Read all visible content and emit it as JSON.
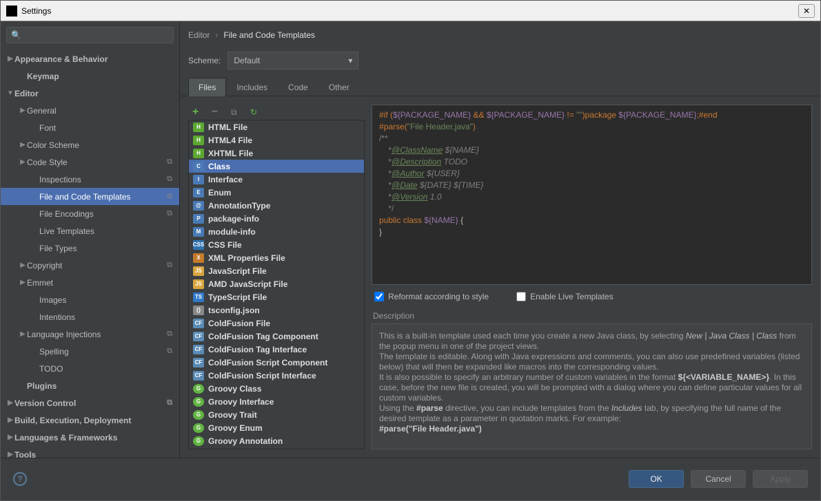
{
  "window": {
    "title": "Settings"
  },
  "search": {
    "placeholder": "Q"
  },
  "sidebar": [
    {
      "label": "Appearance & Behavior",
      "arrow": "closed",
      "bold": true,
      "ind": 0
    },
    {
      "label": "Keymap",
      "bold": true,
      "ind": 1
    },
    {
      "label": "Editor",
      "arrow": "open",
      "bold": true,
      "ind": 0
    },
    {
      "label": "General",
      "arrow": "closed",
      "ind": 1
    },
    {
      "label": "Font",
      "ind": 2
    },
    {
      "label": "Color Scheme",
      "arrow": "closed",
      "ind": 1
    },
    {
      "label": "Code Style",
      "arrow": "closed",
      "ind": 1,
      "copy": true
    },
    {
      "label": "Inspections",
      "ind": 2,
      "copy": true
    },
    {
      "label": "File and Code Templates",
      "ind": 2,
      "copy": true,
      "selected": true
    },
    {
      "label": "File Encodings",
      "ind": 2,
      "copy": true
    },
    {
      "label": "Live Templates",
      "ind": 2
    },
    {
      "label": "File Types",
      "ind": 2
    },
    {
      "label": "Copyright",
      "arrow": "closed",
      "ind": 1,
      "copy": true
    },
    {
      "label": "Emmet",
      "arrow": "closed",
      "ind": 1
    },
    {
      "label": "Images",
      "ind": 2
    },
    {
      "label": "Intentions",
      "ind": 2
    },
    {
      "label": "Language Injections",
      "arrow": "closed",
      "ind": 1,
      "copy": true
    },
    {
      "label": "Spelling",
      "ind": 2,
      "copy": true
    },
    {
      "label": "TODO",
      "ind": 2
    },
    {
      "label": "Plugins",
      "bold": true,
      "ind": 1
    },
    {
      "label": "Version Control",
      "arrow": "closed",
      "bold": true,
      "ind": 0,
      "copy": true
    },
    {
      "label": "Build, Execution, Deployment",
      "arrow": "closed",
      "bold": true,
      "ind": 0
    },
    {
      "label": "Languages & Frameworks",
      "arrow": "closed",
      "bold": true,
      "ind": 0
    },
    {
      "label": "Tools",
      "arrow": "closed",
      "bold": true,
      "ind": 0
    }
  ],
  "breadcrumb": {
    "root": "Editor",
    "current": "File and Code Templates"
  },
  "scheme": {
    "label": "Scheme:",
    "value": "Default"
  },
  "tabs": [
    "Files",
    "Includes",
    "Code",
    "Other"
  ],
  "activeTab": 0,
  "templates": [
    {
      "name": "HTML File",
      "icon": "html",
      "t": "H"
    },
    {
      "name": "HTML4 File",
      "icon": "html",
      "t": "H"
    },
    {
      "name": "XHTML File",
      "icon": "html",
      "t": "H"
    },
    {
      "name": "Class",
      "icon": "cls",
      "t": "C",
      "selected": true
    },
    {
      "name": "Interface",
      "icon": "cls",
      "t": "I"
    },
    {
      "name": "Enum",
      "icon": "cls",
      "t": "E"
    },
    {
      "name": "AnnotationType",
      "icon": "cls",
      "t": "@"
    },
    {
      "name": "package-info",
      "icon": "cls",
      "t": "P"
    },
    {
      "name": "module-info",
      "icon": "cls",
      "t": "M"
    },
    {
      "name": "CSS File",
      "icon": "css",
      "t": "CSS"
    },
    {
      "name": "XML Properties File",
      "icon": "xml",
      "t": "X"
    },
    {
      "name": "JavaScript File",
      "icon": "js",
      "t": "JS"
    },
    {
      "name": "AMD JavaScript File",
      "icon": "js",
      "t": "JS"
    },
    {
      "name": "TypeScript File",
      "icon": "ts",
      "t": "TS"
    },
    {
      "name": "tsconfig.json",
      "icon": "json",
      "t": "{}"
    },
    {
      "name": "ColdFusion File",
      "icon": "cf",
      "t": "CF"
    },
    {
      "name": "ColdFusion Tag Component",
      "icon": "cf",
      "t": "CF"
    },
    {
      "name": "ColdFusion Tag Interface",
      "icon": "cf",
      "t": "CF"
    },
    {
      "name": "ColdFusion Script Component",
      "icon": "cf",
      "t": "CF"
    },
    {
      "name": "ColdFusion Script Interface",
      "icon": "cf",
      "t": "CF"
    },
    {
      "name": "Groovy Class",
      "icon": "groovy",
      "t": "G"
    },
    {
      "name": "Groovy Interface",
      "icon": "groovy",
      "t": "G"
    },
    {
      "name": "Groovy Trait",
      "icon": "groovy",
      "t": "G"
    },
    {
      "name": "Groovy Enum",
      "icon": "groovy",
      "t": "G"
    },
    {
      "name": "Groovy Annotation",
      "icon": "groovy",
      "t": "G"
    }
  ],
  "code": {
    "l1a": "#if (",
    "l1b": "${PACKAGE_NAME}",
    "l1c": " && ",
    "l1d": "${PACKAGE_NAME}",
    "l1e": " != ",
    "l1f": "\"\"",
    "l1g": ")",
    "l1h": "package ",
    "l1i": "${PACKAGE_NAME}",
    "l1j": ";#end",
    "l2a": "#parse(",
    "l2b": "\"File Header.java\"",
    "l2c": ")",
    "l3": "/**",
    "l4a": "    *",
    "l4b": "@ClassName",
    "l4c": " ${NAME}",
    "l5a": "    *",
    "l5b": "@Description",
    "l5c": " TODO",
    "l6a": "    *",
    "l6b": "@Author",
    "l6c": " ${USER}",
    "l7a": "    *",
    "l7b": "@Date",
    "l7c": " ${DATE} ${TIME}",
    "l8a": "    *",
    "l8b": "@Version",
    "l8c": " 1.0",
    "l9": "    */",
    "l10a": "public class ",
    "l10b": "${NAME}",
    "l10c": " {",
    "l11": "}"
  },
  "checkboxes": {
    "reformat": "Reformat according to style",
    "liveTemplates": "Enable Live Templates"
  },
  "descLabel": "Description",
  "description": {
    "t1": "This is a built-in template used each time you create a new Java class, by selecting ",
    "i1": "New | Java Class | Class",
    "t2": " from the popup menu in one of the project views.",
    "t3": "The template is editable. Along with Java expressions and comments, you can also use predefined variables (listed below) that will then be expanded like macros into the corresponding values.",
    "t4": "It is also possible to specify an arbitrary number of custom variables in the format ",
    "b1": "${<VARIABLE_NAME>}",
    "t5": ". In this case, before the new file is created, you will be prompted with a dialog where you can define particular values for all custom variables.",
    "t6": "Using the ",
    "b2": "#parse",
    "t7": " directive, you can include templates from the ",
    "i2": "Includes",
    "t8": " tab, by specifying the full name of the desired template as a parameter in quotation marks. For example:",
    "b3": "#parse(\"File Header.java\")"
  },
  "buttons": {
    "ok": "OK",
    "cancel": "Cancel",
    "apply": "Apply"
  }
}
